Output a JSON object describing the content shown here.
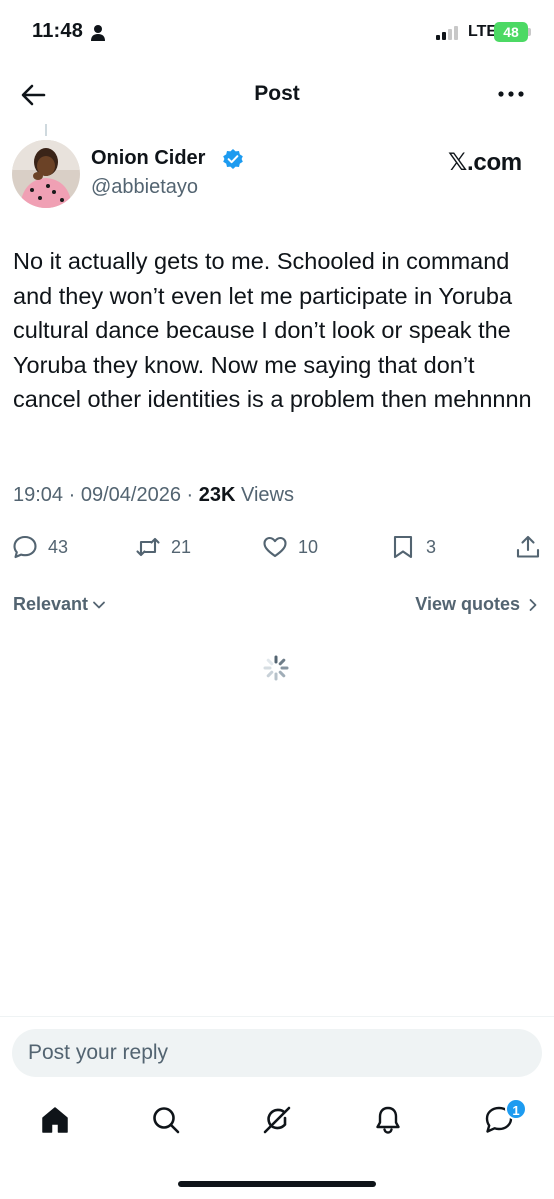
{
  "status_bar": {
    "time": "11:48",
    "network": "LTE",
    "battery": "48"
  },
  "header": {
    "title": "Post"
  },
  "post": {
    "display_name": "Onion Cider",
    "handle": "@abbietayo",
    "source": "𝕏.com",
    "text": "No it actually gets to me. Schooled in command and they won’t even let me participate in Yoruba cultural dance because I don’t look or speak the Yoruba they know. Now me saying that don’t cancel other identities is a problem then mehnnnn",
    "time": "19:04",
    "date": "09/04/2026",
    "views_count": "23K",
    "views_label": "Views",
    "replies": "43",
    "reposts": "21",
    "likes": "10",
    "bookmarks": "3"
  },
  "sort": {
    "relevant_label": "Relevant",
    "view_quotes_label": "View quotes"
  },
  "reply": {
    "placeholder": "Post your reply"
  },
  "tabbar": {
    "messages_badge": "1"
  },
  "colors": {
    "accent": "#1d9bf0",
    "secondary_text": "#536471",
    "battery_green": "#4cd964"
  },
  "icons": [
    "back-arrow-icon",
    "more-icon",
    "verified-badge-icon",
    "reply-icon",
    "repost-icon",
    "like-icon",
    "bookmark-icon",
    "share-icon",
    "chevron-down-icon",
    "chevron-right-icon",
    "spinner-icon",
    "home-icon",
    "search-icon",
    "grok-icon",
    "notifications-icon",
    "messages-icon"
  ]
}
